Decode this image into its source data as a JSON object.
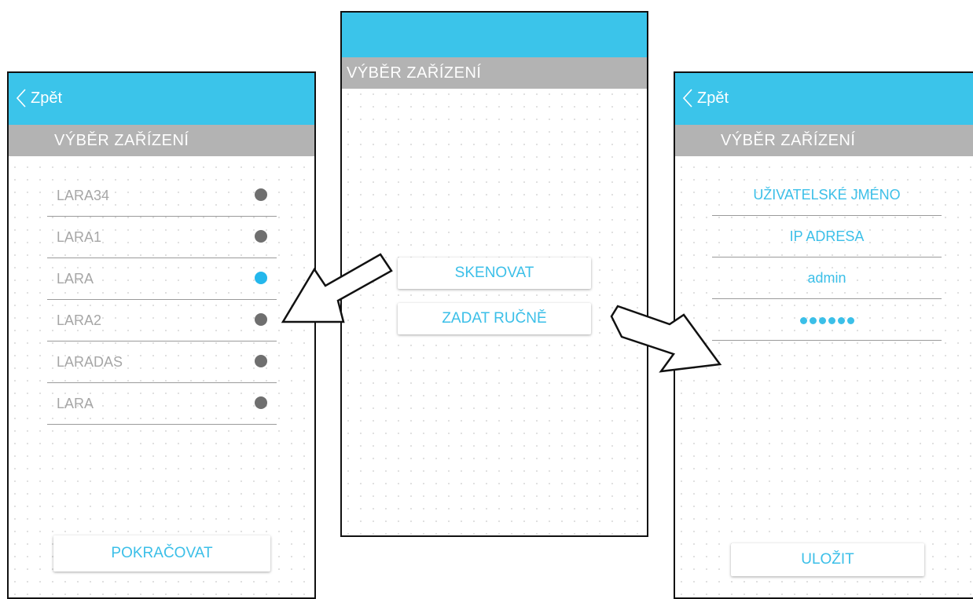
{
  "screens": {
    "left": {
      "back_label": "Zpět",
      "section_title": "VÝBĚR ZAŘÍZENÍ",
      "devices": [
        {
          "name": "LARA34",
          "selected": false
        },
        {
          "name": "LARA1",
          "selected": false
        },
        {
          "name": "LARA",
          "selected": true
        },
        {
          "name": "LARA2",
          "selected": false
        },
        {
          "name": "LARADAS",
          "selected": false
        },
        {
          "name": "LARA",
          "selected": false
        }
      ],
      "continue_label": "POKRAČOVAT"
    },
    "center": {
      "section_title": "VÝBĚR ZAŘÍZENÍ",
      "scan_label": "SKENOVAT",
      "manual_label": "ZADAT RUČNĚ"
    },
    "right": {
      "back_label": "Zpět",
      "section_title": "VÝBĚR ZAŘÍZENÍ",
      "username_label": "UŽIVATELSKÉ JMÉNO",
      "ip_label": "IP ADRESA",
      "login_value": "admin",
      "password_masked": "••••••",
      "save_label": "ULOŽIT"
    }
  },
  "colors": {
    "accent": "#3bc4ea",
    "subbar": "#b3b3b3",
    "dot_inactive": "#6f6f6f",
    "dot_active": "#24b7ec"
  }
}
